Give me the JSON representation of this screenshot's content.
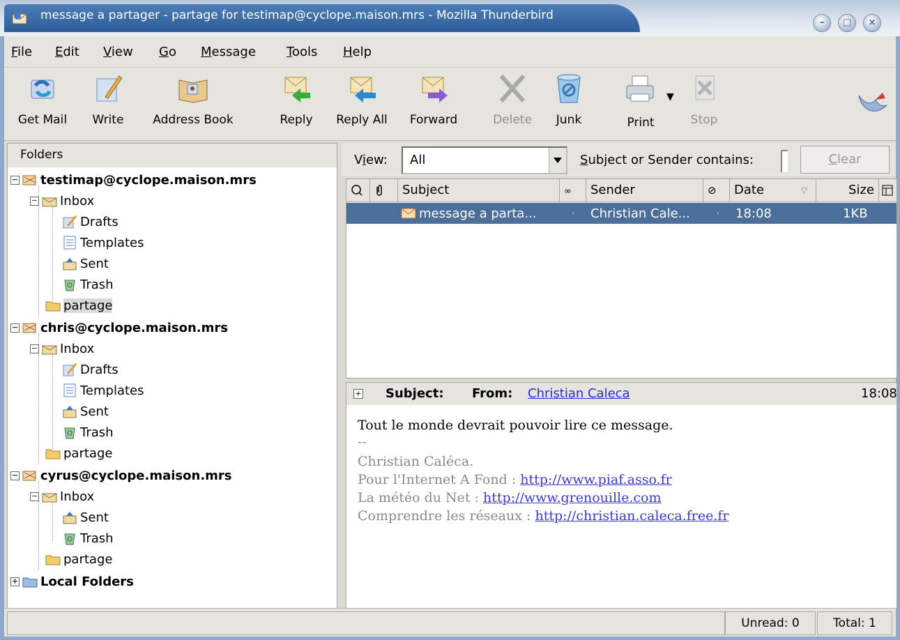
{
  "window": {
    "title": "message a partager - partage for testimap@cyclope.maison.mrs - Mozilla Thunderbird"
  },
  "menu": [
    {
      "mn": "F",
      "rest": "ile"
    },
    {
      "mn": "E",
      "rest": "dit"
    },
    {
      "mn": "V",
      "rest": "iew"
    },
    {
      "mn": "G",
      "rest": "o"
    },
    {
      "mn": "M",
      "rest": "essage"
    },
    {
      "mn": "T",
      "rest": "ools"
    },
    {
      "mn": "H",
      "rest": "elp"
    }
  ],
  "toolbar": {
    "get_mail": "Get Mail",
    "write": "Write",
    "address_book": "Address Book",
    "reply": "Reply",
    "reply_all": "Reply All",
    "forward": "Forward",
    "delete": "Delete",
    "junk": "Junk",
    "print": "Print",
    "stop": "Stop"
  },
  "folders": {
    "header": "Folders",
    "accounts": [
      {
        "name": "testimap@cyclope.maison.mrs",
        "inbox": "Inbox",
        "drafts": "Drafts",
        "templates": "Templates",
        "sent": "Sent",
        "trash": "Trash",
        "partage": "partage"
      },
      {
        "name": "chris@cyclope.maison.mrs",
        "inbox": "Inbox",
        "drafts": "Drafts",
        "templates": "Templates",
        "sent": "Sent",
        "trash": "Trash",
        "partage": "partage"
      },
      {
        "name": "cyrus@cyclope.maison.mrs",
        "inbox": "Inbox",
        "sent": "Sent",
        "trash": "Trash",
        "partage": "partage"
      }
    ],
    "local": "Local Folders"
  },
  "viewbar": {
    "view_mn": "i",
    "view_pre": "V",
    "view_post": "ew:",
    "view_value": "All",
    "search_mn": "S",
    "search_rest": "ubject or Sender contains:",
    "clear_mn": "C",
    "clear_rest": "lear"
  },
  "columns": {
    "subject": "Subject",
    "sender": "Sender",
    "date": "Date",
    "size": "Size"
  },
  "messages": [
    {
      "subject": "message a parta...",
      "sender": "Christian Cale...",
      "date": "18:08",
      "size": "1KB"
    }
  ],
  "preview": {
    "subject_label": "Subject:",
    "from_label": "From:",
    "from_value": "Christian Caleca",
    "time": "18:08",
    "body": "Tout le monde devrait pouvoir lire ce message.",
    "sig_sep": "--",
    "sig_name": "Christian Caléca.",
    "sig1_label": "Pour l'Internet A Fond : ",
    "sig1_link": "http://www.piaf.asso.fr",
    "sig2_label": "La météo du Net : ",
    "sig2_link": "http://www.grenouille.com",
    "sig3_label": "Comprendre les réseaux : ",
    "sig3_link": "http://christian.caleca.free.fr"
  },
  "status": {
    "unread": "Unread: 0",
    "total": "Total: 1"
  }
}
